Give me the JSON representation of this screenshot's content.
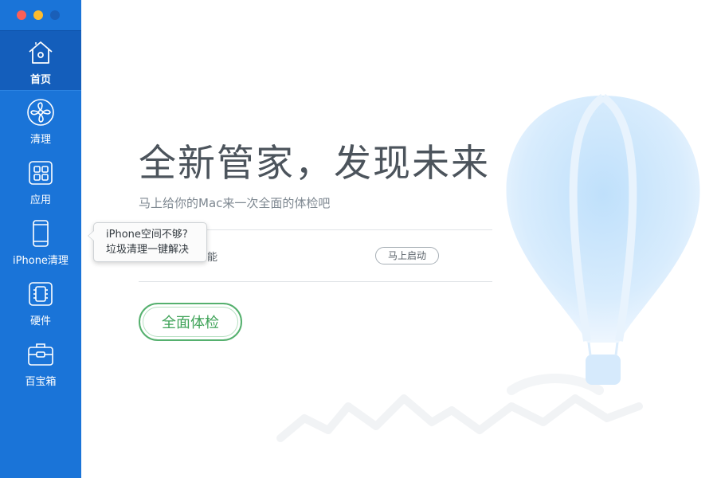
{
  "window": {
    "traffic_lights": [
      "close",
      "minimize",
      "zoom"
    ]
  },
  "sidebar": {
    "items": [
      {
        "label": "首页",
        "icon": "home-icon",
        "active": true
      },
      {
        "label": "清理",
        "icon": "fan-icon",
        "active": false
      },
      {
        "label": "应用",
        "icon": "apps-grid-icon",
        "active": false
      },
      {
        "label": "iPhone清理",
        "icon": "phone-icon",
        "active": false
      },
      {
        "label": "硬件",
        "icon": "chip-icon",
        "active": false
      },
      {
        "label": "百宝箱",
        "icon": "toolbox-icon",
        "active": false
      }
    ]
  },
  "main": {
    "headline": "全新管家，发现未来",
    "subtitle": "马上给你的Mac来一次全面的体检吧",
    "feature_text": "能",
    "launch_button": "马上启动",
    "check_button": "全面体检"
  },
  "tooltip": {
    "line1": "iPhone空间不够?",
    "line2": "垃圾清理一键解决"
  },
  "colors": {
    "sidebar": "#1a74d8",
    "sidebar_active": "#145ebb",
    "accent_green": "#55b06e",
    "headline": "#4c545c"
  }
}
